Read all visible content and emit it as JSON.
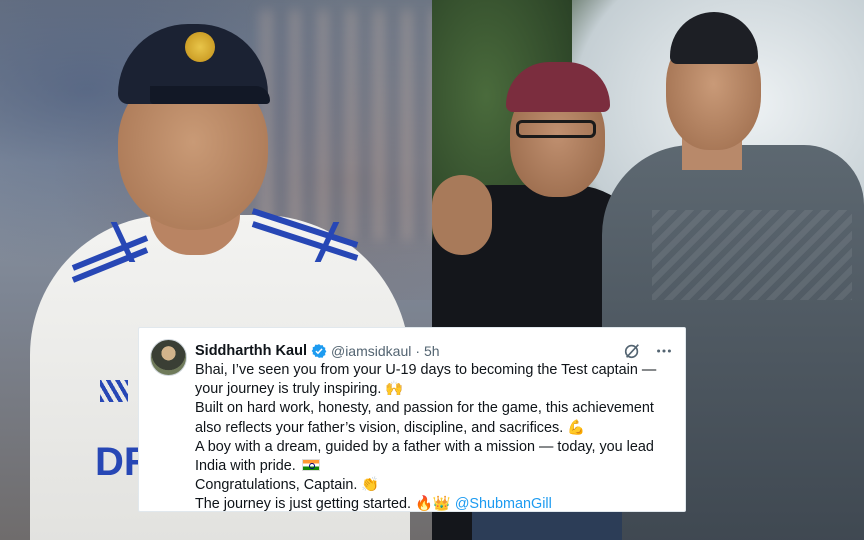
{
  "tweet": {
    "name": "Siddharthh Kaul",
    "handle": "@iamsidkaul",
    "separator": "·",
    "time": "5h",
    "lines": [
      {
        "text": "Bhai, I’ve seen you from your U-19 days to becoming the Test captain —"
      },
      {
        "text": "your journey is truly inspiring. 🙌"
      },
      {
        "text": "Built on hard work, honesty, and passion for the game, this achievement"
      },
      {
        "text": "also reflects your father’s vision, discipline, and sacrifices. 💪"
      },
      {
        "text": "A boy with a dream, guided by a father with a mission — today, you lead"
      },
      {
        "text": "India with pride."
      },
      {
        "text": "Congratulations, Captain. 👏"
      },
      {
        "text": "The journey is just getting started. 🔥👑 "
      }
    ],
    "mention": "@ShubmanGill"
  },
  "colors": {
    "link": "#1d9bf0",
    "text": "#0f1419",
    "muted": "#536471",
    "verified": "#1d9bf0"
  },
  "icons": [
    "verified-badge-icon",
    "grok-icon",
    "more-options-icon",
    "india-flag-icon"
  ]
}
